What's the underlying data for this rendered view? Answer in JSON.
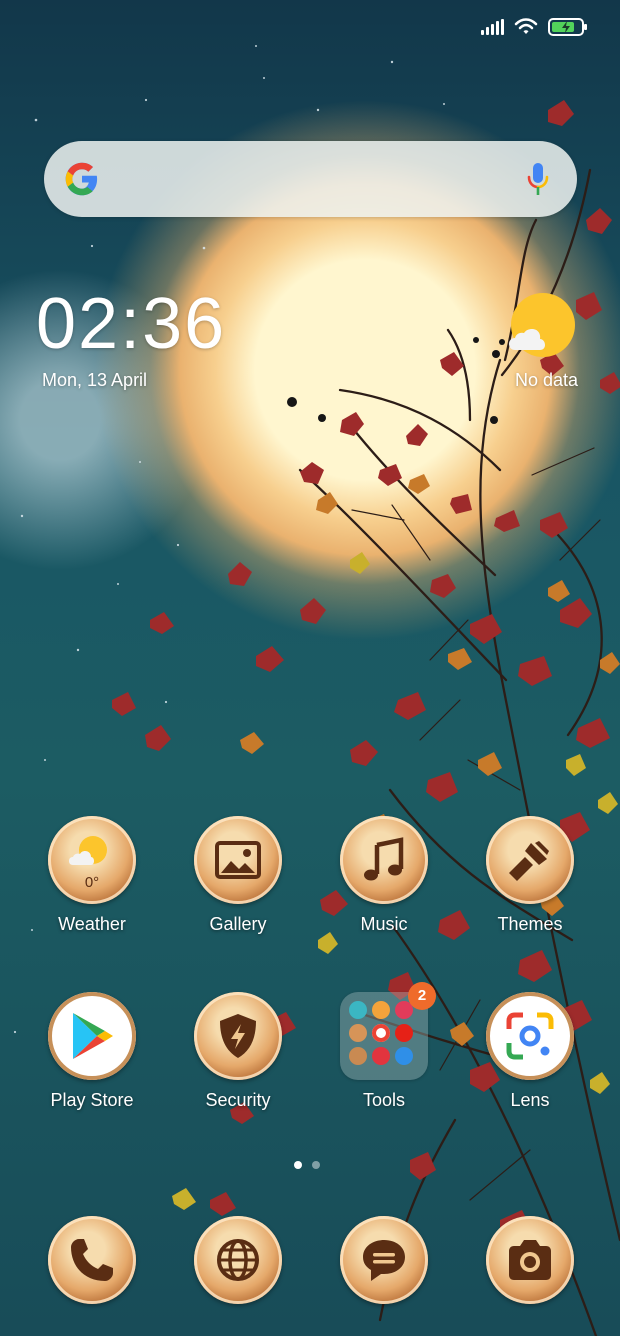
{
  "status_bar": {
    "signal_icon": "cellular-signal-icon",
    "wifi_icon": "wifi-icon",
    "battery_icon": "battery-charging-icon",
    "battery_level": 0.8,
    "colors": {
      "battery": "#52d35b"
    }
  },
  "search": {
    "logo_icon": "google-g-icon",
    "mic_icon": "microphone-icon"
  },
  "clock": {
    "time": "02:36",
    "date": "Mon, 13 April"
  },
  "weather_widget": {
    "icon": "sun-cloud-icon",
    "status": "No data"
  },
  "apps": [
    {
      "label": "Weather",
      "icon": "weather-icon",
      "temperature": "0°"
    },
    {
      "label": "Gallery",
      "icon": "gallery-icon"
    },
    {
      "label": "Music",
      "icon": "music-note-icon"
    },
    {
      "label": "Themes",
      "icon": "paintbrush-icon"
    },
    {
      "label": "Play Store",
      "icon": "play-store-icon"
    },
    {
      "label": "Security",
      "icon": "security-shield-icon"
    },
    {
      "label": "Tools",
      "icon": "folder-icon",
      "badge": "2"
    },
    {
      "label": "Lens",
      "icon": "google-lens-icon"
    }
  ],
  "page_indicator": {
    "pages": 2,
    "current": 1
  },
  "dock": [
    {
      "icon": "phone-icon"
    },
    {
      "icon": "browser-globe-icon"
    },
    {
      "icon": "messages-icon"
    },
    {
      "icon": "camera-icon"
    }
  ],
  "colors": {
    "sky": "#195664",
    "moon": "#f7cf8e",
    "leaf_red": "#9e2b2b",
    "app_icon_gold": "#e5a86a",
    "app_icon_dark": "#5a2d13",
    "badge": "#ef6b2b"
  }
}
